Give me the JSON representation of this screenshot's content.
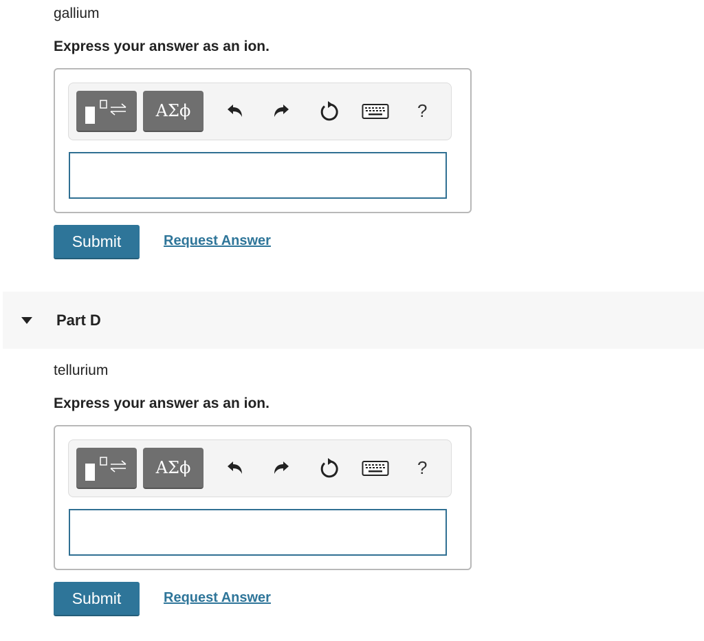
{
  "part_c": {
    "prompt": "gallium",
    "instruction": "Express your answer as an ion.",
    "toolbar": {
      "template_icon": "templates-icon",
      "greek_label": "ΑΣϕ",
      "undo_icon": "undo-icon",
      "redo_icon": "redo-icon",
      "reset_icon": "reset-icon",
      "keyboard_icon": "keyboard-icon",
      "help_label": "?"
    },
    "answer_value": "",
    "submit_label": "Submit",
    "request_label": "Request Answer"
  },
  "part_d": {
    "title": "Part D",
    "toggle_icon": "caret-down-icon",
    "prompt": "tellurium",
    "instruction": "Express your answer as an ion.",
    "toolbar": {
      "template_icon": "templates-icon",
      "greek_label": "ΑΣϕ",
      "undo_icon": "undo-icon",
      "redo_icon": "redo-icon",
      "reset_icon": "reset-icon",
      "keyboard_icon": "keyboard-icon",
      "help_label": "?"
    },
    "answer_value": "",
    "submit_label": "Submit",
    "request_label": "Request Answer"
  },
  "colors": {
    "accent": "#2e7599",
    "toolbar_button": "#6f6f6f",
    "input_border": "#2f6f92",
    "section_header_bg": "#f7f7f7"
  }
}
